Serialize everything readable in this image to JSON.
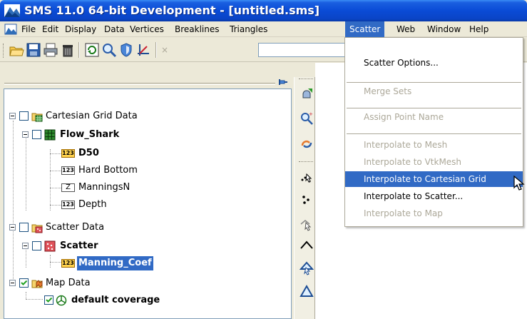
{
  "window": {
    "title": "SMS 11.0 64-bit Development - [untitled.sms]"
  },
  "menubar": {
    "items": [
      {
        "label": "File"
      },
      {
        "label": "Edit"
      },
      {
        "label": "Display"
      },
      {
        "label": "Data"
      },
      {
        "label": "Vertices"
      },
      {
        "label": "Breaklines"
      },
      {
        "label": "Triangles"
      },
      {
        "label": "Scatter"
      },
      {
        "label": "Web"
      },
      {
        "label": "Window"
      },
      {
        "label": "Help"
      }
    ],
    "active": "Scatter"
  },
  "toolbar": {
    "field_value": "",
    "field_prefix": "×"
  },
  "tree": {
    "items": [
      {
        "label": "Cartesian Grid Data",
        "checked": false
      },
      {
        "label": "Flow_Shark",
        "checked": false
      },
      {
        "label": "D50",
        "badge": "123"
      },
      {
        "label": "Hard Bottom",
        "badge": "123"
      },
      {
        "label": "ManningsN",
        "badge": "Z"
      },
      {
        "label": "Depth",
        "badge": "123"
      },
      {
        "label": "Scatter Data",
        "checked": false
      },
      {
        "label": "Scatter",
        "checked": false
      },
      {
        "label": "Manning_Coef",
        "badge": "123",
        "selected": true
      },
      {
        "label": "Map Data",
        "checked": true
      },
      {
        "label": "default coverage",
        "checked": true
      }
    ]
  },
  "scatter_menu": {
    "items": [
      {
        "label": "Scatter Options...",
        "enabled": true
      },
      {
        "label": "Merge Sets",
        "enabled": false
      },
      {
        "label": "Assign Point Name",
        "enabled": false
      },
      {
        "label": "Interpolate to Mesh",
        "enabled": false
      },
      {
        "label": "Interpolate to VtkMesh",
        "enabled": false
      },
      {
        "label": "Interpolate to Cartesian Grid",
        "enabled": true,
        "highlighted": true
      },
      {
        "label": "Interpolate to Scatter...",
        "enabled": true
      },
      {
        "label": "Interpolate to Map",
        "enabled": false
      }
    ]
  },
  "colors": {
    "selection": "#316ac5",
    "titlebar": "#0a4bd6",
    "disabled_text": "#aca899"
  }
}
